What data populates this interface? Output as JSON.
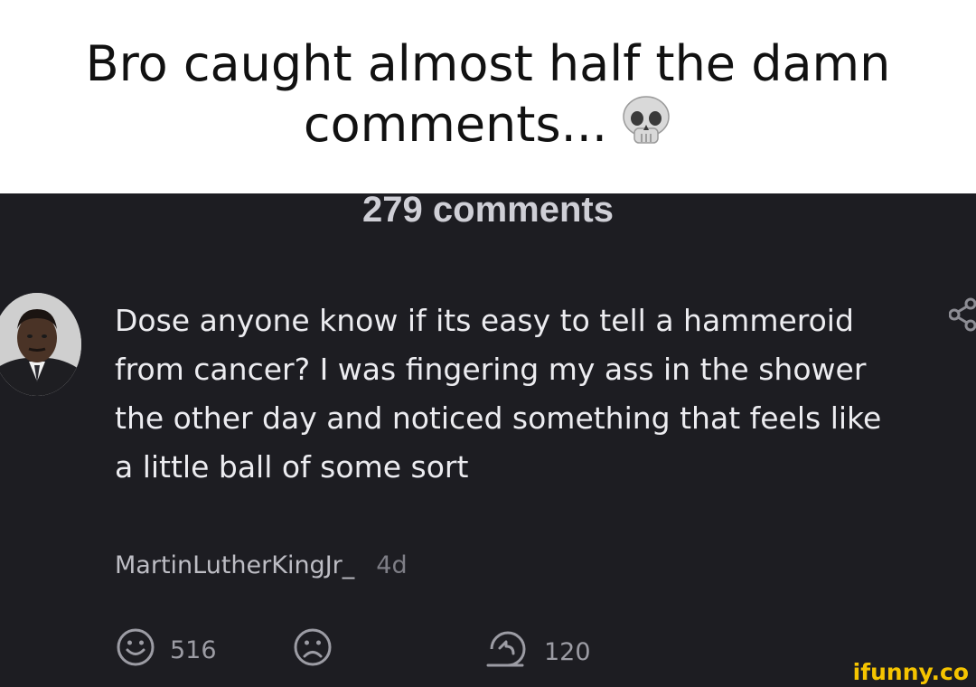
{
  "caption": {
    "line1": "Bro caught almost half the damn",
    "line2": "comments...",
    "emoji": "skull-emoji"
  },
  "thread": {
    "comment_count": "279 comments"
  },
  "comment": {
    "avatar_icon": "user-avatar",
    "text": "Dose anyone know if its easy to tell a hammeroid from cancer? I was fingering my ass in the shower the other day and noticed something that feels like a little ball of some sort",
    "username": "MartinLutherKingJr_",
    "age": "4d",
    "share_icon": "share-icon",
    "actions": {
      "smile_icon": "smile-icon",
      "likes": "516",
      "frown_icon": "frown-icon",
      "reply_icon": "reply-icon",
      "replies": "120"
    }
  },
  "watermark": {
    "text": "ifunny.co"
  },
  "colors": {
    "panel_bg": "#1d1d22",
    "comment_text": "#ececf0",
    "muted_text": "#9c9ca4",
    "watermark": "#f5c400"
  }
}
